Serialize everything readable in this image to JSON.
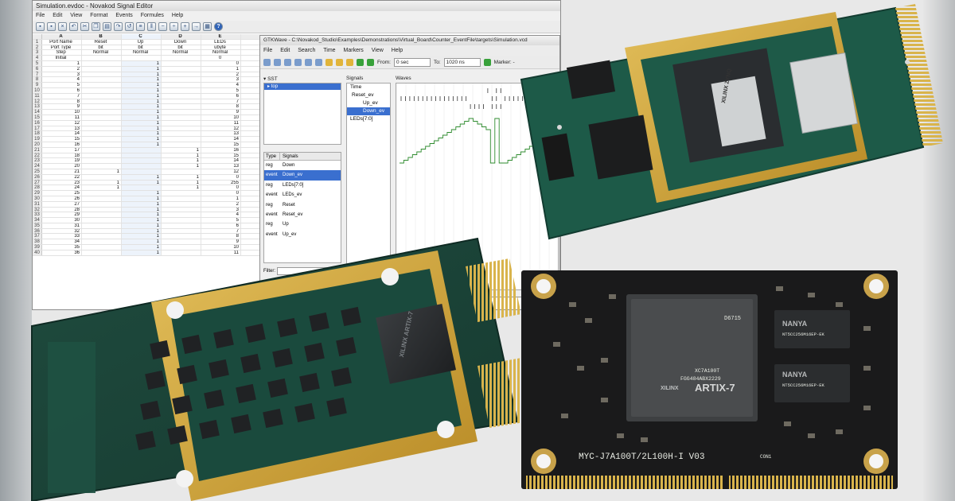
{
  "editor": {
    "title": "Simulation.evdoc - Novakod Signal Editor",
    "menu": [
      "File",
      "Edit",
      "View",
      "Format",
      "Events",
      "Formules",
      "Help"
    ],
    "toolbar_icons": [
      "save-icon",
      "save-all-icon",
      "close-doc-icon",
      "undo-icon",
      "cut-icon",
      "copy-icon",
      "paste-icon",
      "redo-icon",
      "undo2-icon",
      "insert-row-icon",
      "insert-col-icon",
      "delete-row-icon",
      "delete-col-icon",
      "add-icon",
      "export-icon",
      "fill-icon",
      "help-icon"
    ],
    "columns": [
      "",
      "A",
      "B",
      "C",
      "D",
      "E"
    ],
    "header_rows": [
      [
        "1",
        "Port Name",
        "Reset",
        "Up",
        "Down",
        "LEDs"
      ],
      [
        "2",
        "Port Type",
        "bit",
        "bit",
        "bit",
        "ubyte"
      ],
      [
        "3",
        "Step",
        "Normal",
        "Normal",
        "Normal",
        "Normal"
      ],
      [
        "4",
        "Initial",
        "",
        "",
        "",
        "0"
      ]
    ],
    "data_rows": [
      [
        "5",
        "1",
        "",
        "1",
        "",
        "0"
      ],
      [
        "6",
        "2",
        "",
        "1",
        "",
        "1"
      ],
      [
        "7",
        "3",
        "",
        "1",
        "",
        "2"
      ],
      [
        "8",
        "4",
        "",
        "1",
        "",
        "3"
      ],
      [
        "9",
        "5",
        "",
        "1",
        "",
        "4"
      ],
      [
        "10",
        "6",
        "",
        "1",
        "",
        "5"
      ],
      [
        "11",
        "7",
        "",
        "1",
        "",
        "6"
      ],
      [
        "12",
        "8",
        "",
        "1",
        "",
        "7"
      ],
      [
        "13",
        "9",
        "",
        "1",
        "",
        "8"
      ],
      [
        "14",
        "10",
        "",
        "1",
        "",
        "9"
      ],
      [
        "15",
        "11",
        "",
        "1",
        "",
        "10"
      ],
      [
        "16",
        "12",
        "",
        "1",
        "",
        "11"
      ],
      [
        "17",
        "13",
        "",
        "1",
        "",
        "12"
      ],
      [
        "18",
        "14",
        "",
        "1",
        "",
        "13"
      ],
      [
        "19",
        "15",
        "",
        "1",
        "",
        "14"
      ],
      [
        "20",
        "16",
        "",
        "1",
        "",
        "15"
      ],
      [
        "21",
        "17",
        "",
        "",
        "1",
        "16"
      ],
      [
        "22",
        "18",
        "",
        "",
        "1",
        "15"
      ],
      [
        "23",
        "19",
        "",
        "",
        "1",
        "14"
      ],
      [
        "24",
        "20",
        "",
        "",
        "1",
        "13"
      ],
      [
        "25",
        "21",
        "1",
        "",
        "",
        "12"
      ],
      [
        "26",
        "22",
        "",
        "1",
        "1",
        "0"
      ],
      [
        "27",
        "23",
        "1",
        "1",
        "1",
        "255"
      ],
      [
        "28",
        "24",
        "1",
        "",
        "1",
        "0"
      ],
      [
        "29",
        "25",
        "",
        "1",
        "",
        "0"
      ],
      [
        "30",
        "26",
        "",
        "1",
        "",
        "1"
      ],
      [
        "31",
        "27",
        "",
        "1",
        "",
        "2"
      ],
      [
        "32",
        "28",
        "",
        "1",
        "",
        "3"
      ],
      [
        "33",
        "29",
        "",
        "1",
        "",
        "4"
      ],
      [
        "34",
        "30",
        "",
        "1",
        "",
        "5"
      ],
      [
        "35",
        "31",
        "",
        "1",
        "",
        "6"
      ],
      [
        "36",
        "32",
        "",
        "1",
        "",
        "7"
      ],
      [
        "37",
        "33",
        "",
        "1",
        "",
        "8"
      ],
      [
        "38",
        "34",
        "",
        "1",
        "",
        "9"
      ],
      [
        "39",
        "35",
        "",
        "1",
        "",
        "10"
      ],
      [
        "40",
        "36",
        "",
        "1",
        "",
        "11"
      ]
    ]
  },
  "gtkwave": {
    "title": "GTKWave - C:\\Novakod_Studio\\Examples\\Demonstrations\\Virtual_Board\\Counter_EventFile\\targets\\Simulation.vcd",
    "menu": [
      "File",
      "Edit",
      "Search",
      "Time",
      "Markers",
      "View",
      "Help"
    ],
    "from_label": "From:",
    "from_value": "0 sec",
    "to_label": "To:",
    "to_value": "1020 ns",
    "marker_label": "Marker: -",
    "sst_label": "SST",
    "sst_item": "top",
    "signals_label": "Signals",
    "waves_label": "Waves",
    "signal_list": [
      "Time",
      "Reset_ev",
      "Up_ev",
      "Down_ev",
      "LEDs[7:0]"
    ],
    "selected_signal_index": 3,
    "type_header": [
      "Type",
      "Signals"
    ],
    "type_rows": [
      [
        "reg",
        "Down"
      ],
      [
        "event",
        "Down_ev"
      ],
      [
        "reg",
        "LEDs[7:0]"
      ],
      [
        "event",
        "LEDs_ev"
      ],
      [
        "reg",
        "Reset"
      ],
      [
        "event",
        "Reset_ev"
      ],
      [
        "reg",
        "Up"
      ],
      [
        "event",
        "Up_ev"
      ]
    ],
    "selected_type_index": 1,
    "filter_label": "Filter:"
  },
  "boards": {
    "top_right": {
      "chip": "XILINX ZYNQ"
    },
    "bottom_left": {
      "chip": "XILINX ARTIX-7"
    },
    "bottom_right": {
      "silkscreen": "MYC-J7A100T/2L100H-I V03",
      "fpga_brand": "XILINX",
      "fpga_family": "ARTIX-7",
      "fpga_part": "XC7A100T",
      "fpga_sub": "FGG484ABX2229",
      "fpga_code": "D6715",
      "mem_brand": "NANYA",
      "mem_code_1": "NT5CC256M16EP-EK",
      "mem_code_2": "NT5CC256M16EP-EK",
      "conn_label": "CON1"
    }
  }
}
